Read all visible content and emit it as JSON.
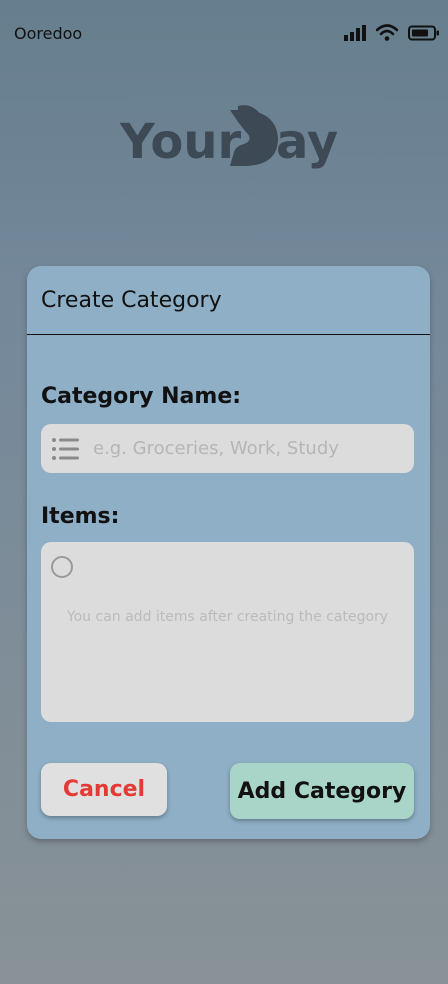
{
  "status_bar": {
    "carrier": "Ooredoo",
    "icons": [
      "signal-icon",
      "wifi-icon",
      "battery-icon"
    ]
  },
  "logo": {
    "text_part1": "Your",
    "text_part2": "ay",
    "color": "#3d4a55"
  },
  "modal": {
    "title": "Create Category",
    "category_name_label": "Category Name:",
    "category_name_placeholder": "e.g. Groceries, Work, Study",
    "category_name_value": "",
    "items_label": "Items:",
    "items_hint": "You can add items after creating the category",
    "cancel_label": "Cancel",
    "add_label": "Add Category"
  },
  "colors": {
    "modal_bg": "#8eafc6",
    "cancel_text": "#e53935",
    "add_bg": "#a8d5c8",
    "input_bg": "#dcdcdc"
  }
}
